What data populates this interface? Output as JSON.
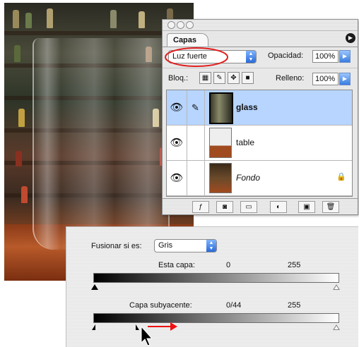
{
  "palette": {
    "tab_label": "Capas",
    "blend_mode": "Luz fuerte",
    "opacity_label": "Opacidad:",
    "opacity_value": "100%",
    "lock_label": "Bloq.:",
    "fill_label": "Relleno:",
    "fill_value": "100%",
    "layers": [
      {
        "name": "glass",
        "selected": true
      },
      {
        "name": "table",
        "selected": false
      },
      {
        "name": "Fondo",
        "selected": false
      }
    ]
  },
  "blend_if": {
    "label": "Fusionar si es:",
    "channel": "Gris",
    "this_layer_label": "Esta capa:",
    "this_layer_min": "0",
    "this_layer_max": "255",
    "underlying_label": "Capa subyacente:",
    "underlying_min": "0/44",
    "underlying_max": "255"
  },
  "colors": {
    "highlight_ellipse": "#e02020",
    "arrow": "#e02020",
    "selected_row": "#b7d5ff"
  }
}
